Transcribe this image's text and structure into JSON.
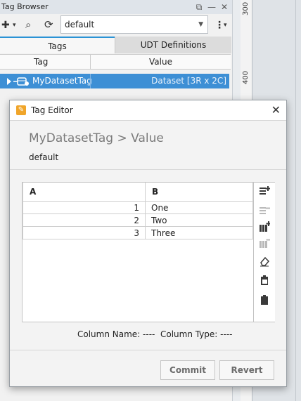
{
  "tag_browser": {
    "title": "Tag Browser",
    "window_icons": {
      "restore": "⧉",
      "minimize": "—",
      "close": "✕"
    },
    "toolbar": {
      "add": "✚",
      "add_arrow": "▾",
      "search": "⌕",
      "refresh": "⟳",
      "more": "⋮",
      "more_arrow": "▾"
    },
    "provider": {
      "value": "default",
      "arrow": "▼"
    },
    "tabs": [
      {
        "label": "Tags"
      },
      {
        "label": "UDT Definitions"
      }
    ],
    "columns": {
      "tag": "Tag",
      "value": "Value"
    },
    "rows": [
      {
        "tag": "MyDatasetTag",
        "value": "Dataset [3R x 2C]"
      }
    ],
    "ruler_marks": [
      "300",
      "400"
    ]
  },
  "tag_editor": {
    "title": "Tag Editor",
    "breadcrumb": "MyDatasetTag > Value",
    "dataset_name": "default",
    "columns": [
      "A",
      "B"
    ],
    "rows": [
      [
        "1",
        "One"
      ],
      [
        "2",
        "Two"
      ],
      [
        "3",
        "Three"
      ]
    ],
    "column_info": "Column Name: ----  Column Type: ----",
    "buttons": {
      "commit": "Commit",
      "revert": "Revert"
    },
    "close": "✕"
  },
  "colors": {
    "selection": "#3d8fd5",
    "accent": "#2a93d5",
    "dialog_icon": "#f0a52a"
  }
}
